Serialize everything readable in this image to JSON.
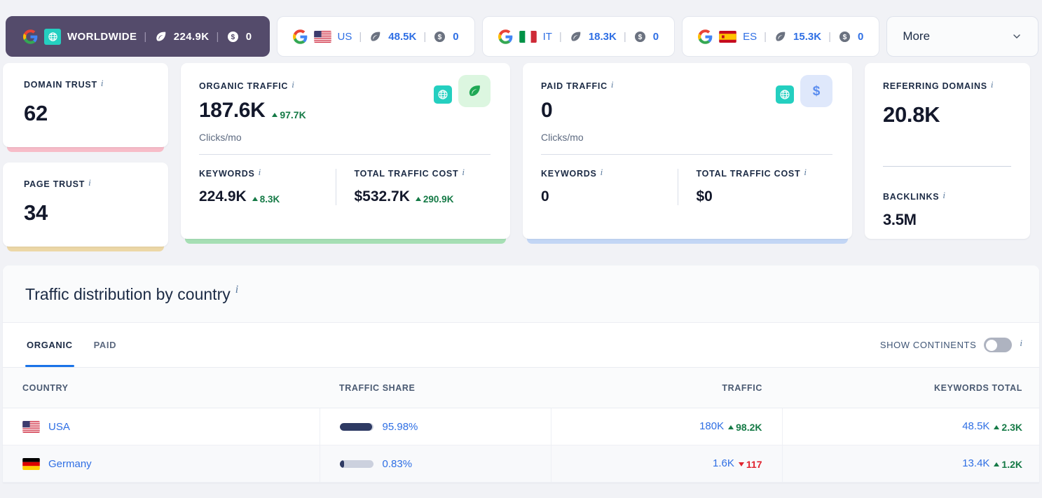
{
  "topbar": {
    "tabs": [
      {
        "name": "WORLDWIDE",
        "flag": "globe-badge",
        "traffic": "224.9K",
        "cost": "0",
        "active": true
      },
      {
        "name": "US",
        "flag": "us",
        "traffic": "48.5K",
        "cost": "0",
        "active": false
      },
      {
        "name": "IT",
        "flag": "it",
        "traffic": "18.3K",
        "cost": "0",
        "active": false
      },
      {
        "name": "ES",
        "flag": "es",
        "traffic": "15.3K",
        "cost": "0",
        "active": false
      }
    ],
    "more_label": "More",
    "separator": "|"
  },
  "cards": {
    "domain_trust": {
      "label": "DOMAIN TRUST",
      "value": "62",
      "accent": "#f7bcc8"
    },
    "page_trust": {
      "label": "PAGE TRUST",
      "value": "34",
      "accent": "#ecd7a6"
    },
    "organic": {
      "label": "ORGANIC TRAFFIC",
      "value": "187.6K",
      "delta": "97.7K",
      "delta_dir": "up",
      "unit": "Clicks/mo",
      "keywords_label": "KEYWORDS",
      "keywords_value": "224.9K",
      "keywords_delta": "8.3K",
      "keywords_delta_dir": "up",
      "cost_label": "TOTAL TRAFFIC COST",
      "cost_value": "$532.7K",
      "cost_delta": "290.9K",
      "cost_delta_dir": "up",
      "accent": "#a6dfb4"
    },
    "paid": {
      "label": "PAID TRAFFIC",
      "value": "0",
      "unit": "Clicks/mo",
      "keywords_label": "KEYWORDS",
      "keywords_value": "0",
      "cost_label": "TOTAL TRAFFIC COST",
      "cost_value": "$0",
      "accent": "#c3d6f5"
    },
    "referring": {
      "label": "REFERRING DOMAINS",
      "value": "20.8K",
      "backlinks_label": "BACKLINKS",
      "backlinks_value": "3.5M"
    }
  },
  "distribution": {
    "title": "Traffic distribution by country",
    "tabs": [
      {
        "label": "ORGANIC",
        "active": true
      },
      {
        "label": "PAID",
        "active": false
      }
    ],
    "toggle_label": "SHOW CONTINENTS",
    "toggle_on": false,
    "columns": {
      "country": "COUNTRY",
      "share": "TRAFFIC SHARE",
      "traffic": "TRAFFIC",
      "keywords": "KEYWORDS TOTAL"
    },
    "rows": [
      {
        "country": "USA",
        "flag": "us",
        "share_pct": "95.98%",
        "share_fill": 96,
        "traffic": "180K",
        "traffic_delta": "98.2K",
        "traffic_dir": "up",
        "keywords": "48.5K",
        "keywords_delta": "2.3K",
        "keywords_dir": "up"
      },
      {
        "country": "Germany",
        "flag": "de",
        "share_pct": "0.83%",
        "share_fill": 14,
        "traffic": "1.6K",
        "traffic_delta": "117",
        "traffic_dir": "down",
        "keywords": "13.4K",
        "keywords_delta": "1.2K",
        "keywords_dir": "up"
      }
    ]
  },
  "chart_data": {
    "type": "bar",
    "title": "Traffic distribution by country",
    "categories": [
      "USA",
      "Germany"
    ],
    "values": [
      95.98,
      0.83
    ],
    "ylabel": "Traffic share (%)",
    "ylim": [
      0,
      100
    ]
  }
}
